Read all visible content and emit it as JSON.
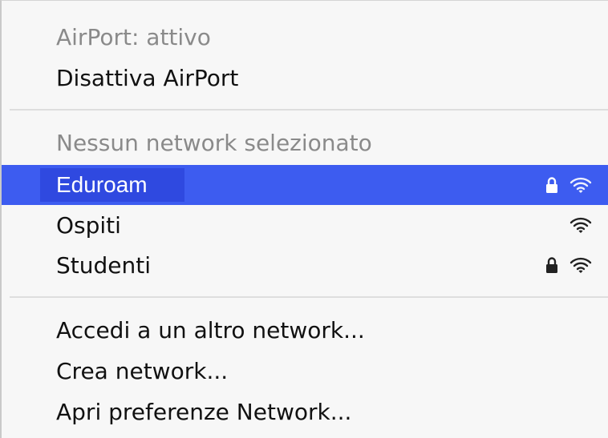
{
  "airport": {
    "status": "AirPort: attivo",
    "toggle_label": "Disattiva AirPort"
  },
  "networks": {
    "header": "Nessun network selezionato",
    "items": [
      {
        "name": "Eduroam",
        "locked": true,
        "selected": true
      },
      {
        "name": "Ospiti",
        "locked": false,
        "selected": false
      },
      {
        "name": "Studenti",
        "locked": true,
        "selected": false
      }
    ]
  },
  "actions": {
    "join_other": "Accedi a un altro network...",
    "create": "Crea network...",
    "open_prefs": "Apri preferenze Network..."
  },
  "colors": {
    "selection": "#3d5cf0",
    "disabled_text": "#8a8a8a"
  },
  "icons": {
    "lock": "lock-icon",
    "wifi": "wifi-icon"
  }
}
